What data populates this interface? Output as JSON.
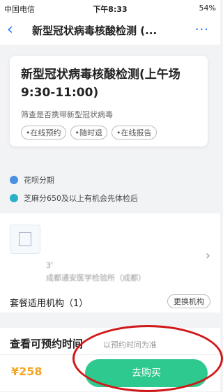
{
  "status": {
    "carrier": "中国电信",
    "time": "下午8:33",
    "battery": "54%"
  },
  "nav": {
    "title": "新型冠状病毒核酸检测 (...",
    "more": "···"
  },
  "product": {
    "name": "新型冠状病毒核酸检测(上午场 9:30-11:00)",
    "desc": "筛查是否携带新型冠状病毒",
    "tags": [
      "在线预约",
      "随时退",
      "在线报告"
    ]
  },
  "promos": [
    "花呗分期",
    "芝麻分650及以上有机会先体检后"
  ],
  "institution": {
    "label": "套餐适用机构（1）",
    "change": "更换机构",
    "blur1": "3'",
    "blur2": "成都通安医学检验所（成都）"
  },
  "booking": {
    "title": "查看可预约时间",
    "note": "以预约时间为准"
  },
  "bottom": {
    "price": "¥258",
    "buy": "去购买"
  },
  "colors": {
    "accent": "#1677ff",
    "buy": "#2ec98e",
    "price": "#f5a623",
    "annotation": "#d01818"
  }
}
